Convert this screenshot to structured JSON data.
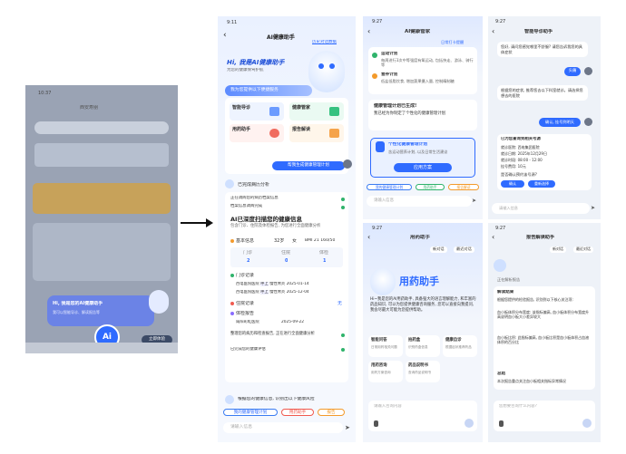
{
  "p1": {
    "time": "10:37",
    "title": "西安寿朋",
    "ai_banner_title": "Hi, 我是您的AI健康助手",
    "ai_banner_sub": "我可以智能导诊、解读报告等",
    "ai_badge": "Ai",
    "try_button": "立即体验"
  },
  "p2": {
    "time": "9:11",
    "title": "AI健康助手",
    "history_link": "历史对话数据",
    "hero_title": "Hi, 我是AI健康助手",
    "hero_sub": "为您的健康保驾护航",
    "service_title": "我为您提供以下便捷服务",
    "services": [
      "智能导诊",
      "健康管家",
      "用药助手",
      "报告解读"
    ],
    "gen_plan_button": "帮我生成健康管理计划",
    "analysis_label": "已完成病历分析",
    "check1": "正在调阅您的病历档案信息",
    "check2": "档案信息调阅完成",
    "scan_title": "AI已深度扫描您的健康信息",
    "scan_desc": "包含门诊、住院及体检报告, 为您进行全面健康分析",
    "basic_label": "基本信息",
    "age": "32岁",
    "gender": "女",
    "bmi": "BMI 21 160/50",
    "stats": [
      {
        "label": "门诊",
        "value": "2"
      },
      {
        "label": "住院",
        "value": "0"
      },
      {
        "label": "体检",
        "value": "1"
      }
    ],
    "outpatient_label": "门诊记录",
    "records": [
      {
        "hosp": "西电医院医院",
        "dept": "呼上",
        "diag": "慢性胃炎",
        "date": "2025-01-14"
      },
      {
        "hosp": "西电医院医院",
        "dept": "呼上",
        "diag": "慢性胃炎",
        "date": "2025-12-04"
      }
    ],
    "inpatient_label": "住院记录",
    "inpatient_value": "无",
    "exam_label": "体检报告",
    "exam_hosp": "咸阳彩虹医院",
    "exam_date": "2025-09-22",
    "check3": "整理您的病历和检查报告, 正在进行全面健康分析",
    "check4": "已完成您的健康评估",
    "risk_text": "根据您的健康信息, 识别出以下健康风险",
    "chips": [
      "我的健康管理计划",
      "用药助手",
      "报告"
    ],
    "input_placeholder": "请输入信息"
  },
  "p3": {
    "time": "9:27",
    "title": "AI健康管家",
    "top_right": "日常打卡提醒",
    "items": [
      {
        "title": "运动计划",
        "desc": "每周进行3次中等强度有氧运动, 包括快走、游泳、骑行等"
      },
      {
        "title": "营养计划",
        "desc": "低盐低脂饮食, 增加蔬果摄入量, 控制精制糖"
      }
    ],
    "done_title": "健康管理计划已生成!",
    "done_desc": "我已经为你制定了个性化的健康管理计划",
    "plan_title": "个性化健康管理计划",
    "plan_desc": "含运动营养计划, 以及日常生活建议",
    "apply_button": "应用方案",
    "chips": [
      "我的健康管理计划",
      "用药助手",
      "报告解读"
    ],
    "input_placeholder": "请输入信息"
  },
  "p4": {
    "time": "9:27",
    "title": "智能导诊助手",
    "q1": "您好, 请问您感觉哪里不舒服? 请您告诉我您的具体症状",
    "u1": "头痛",
    "q2": "根据您的症状, 推荐您去以下科室就诊。请选择您想去的医院",
    "u2": "确认, 挂号到明天",
    "info_title": "已为您查询到相关号源",
    "schedule": [
      "就诊医院: 西电集团医院",
      "就诊日期: 2025年12月29日",
      "就诊时段: 08:00 - 12:00",
      "挂号费用: 10元"
    ],
    "confirm_question": "是否确认预约该号源?",
    "buttons": [
      "确认",
      "重新选择"
    ],
    "input_placeholder": "请输入信息"
  },
  "p5": {
    "time": "9:27",
    "title": "用药助手",
    "top_btns": [
      "新对话",
      "最近对话"
    ],
    "hero": "用药助手",
    "intro": "Hi~我是您的AI用药助手, 具备强大的语言理解能力, 和丰富的药品知识, 可以为您提供健康咨询服务, 您可以直接向我提问, 我会尽最大可能为您提供帮助。",
    "cards": [
      {
        "title": "智能问答",
        "desc": "日常用药相关问题"
      },
      {
        "title": "拍药盒",
        "desc": "识别药盒信息"
      },
      {
        "title": "健康自诊",
        "desc": "根据症状推荐药品"
      },
      {
        "title": "用药咨询",
        "desc": "用药方案咨询"
      },
      {
        "title": "药品说明书",
        "desc": "查询药品说明书"
      }
    ],
    "input_placeholder": "请输入咨询内容"
  },
  "p6": {
    "time": "9:27",
    "title": "报告解读助手",
    "top_btns": [
      "新对话",
      "最近对话"
    ],
    "loading": "正在解析报告",
    "result_title": "解读结果",
    "result_intro": "根据您提供的检验报告, 识别到以下核心关注项:",
    "points": [
      "血小板体积分布宽度: 该指标偏高, 血小板体积分布宽度升高说明血小板大小差异较大",
      "血小板比积: 此指标偏高, 血小板比积是血小板体积占血液体积的百分比"
    ],
    "summary_title": "总结",
    "summary": "本次报告重点关注血小板相关指标异常情况",
    "input_placeholder": "您想要咨询什么内容?"
  },
  "colors": {
    "primary": "#2f6bff",
    "green": "#2fb36b",
    "orange": "#f39a2b",
    "red": "#f05a4f"
  }
}
